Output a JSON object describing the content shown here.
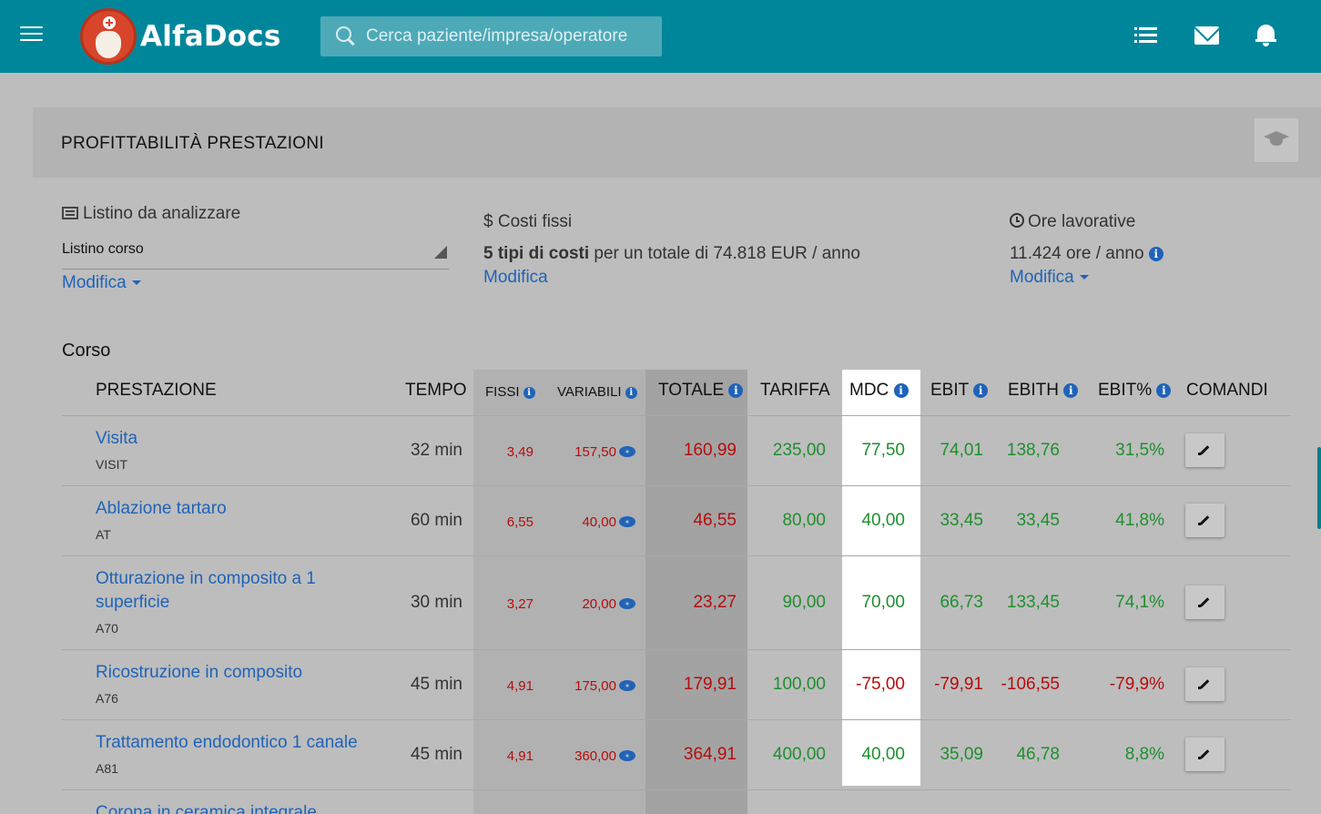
{
  "app": {
    "brand": "AlfaDocs",
    "search_placeholder": "Cerca paziente/impresa/operatore"
  },
  "page": {
    "title": "PROFITTABILITÀ PRESTAZIONI"
  },
  "listino": {
    "label": "Listino da analizzare",
    "value": "Listino corso",
    "action": "Modifica"
  },
  "costi": {
    "label": "$ Costi fissi",
    "summary_bold": "5 tipi di costi",
    "summary_rest": " per un totale di 74.818 EUR / anno",
    "action": "Modifica"
  },
  "ore": {
    "label": "Ore lavorative",
    "value": "11.424 ore / anno",
    "action": "Modifica"
  },
  "table": {
    "title": "Corso",
    "headers": {
      "prestazione": "PRESTAZIONE",
      "tempo": "TEMPO",
      "fissi": "FISSI",
      "variabili": "VARIABILI",
      "totale": "TOTALE",
      "tariffa": "TARIFFA",
      "mdc": "MDC",
      "ebit": "EBIT",
      "ebith": "EBITH",
      "ebitp": "EBIT%",
      "comandi": "COMANDI"
    },
    "rows": [
      {
        "name1": "Visita",
        "name2": "",
        "code": "VISIT",
        "tempo": "32 min",
        "fissi": "3,49",
        "variabili": "157,50",
        "totale": "160,99",
        "tariffa": "235,00",
        "mdc": "77,50",
        "ebit": "74,01",
        "ebith": "138,76",
        "ebitp": "31,5%"
      },
      {
        "name1": "Ablazione tartaro",
        "name2": "",
        "code": "AT",
        "tempo": "60 min",
        "fissi": "6,55",
        "variabili": "40,00",
        "totale": "46,55",
        "tariffa": "80,00",
        "mdc": "40,00",
        "ebit": "33,45",
        "ebith": "33,45",
        "ebitp": "41,8%"
      },
      {
        "name1": "Otturazione in composito a 1",
        "name2": "superficie",
        "code": "A70",
        "tempo": "30 min",
        "fissi": "3,27",
        "variabili": "20,00",
        "totale": "23,27",
        "tariffa": "90,00",
        "mdc": "70,00",
        "ebit": "66,73",
        "ebith": "133,45",
        "ebitp": "74,1%"
      },
      {
        "name1": "Ricostruzione in composito",
        "name2": "",
        "code": "A76",
        "tempo": "45 min",
        "fissi": "4,91",
        "variabili": "175,00",
        "totale": "179,91",
        "tariffa": "100,00",
        "mdc": "-75,00",
        "ebit": "-79,91",
        "ebith": "-106,55",
        "ebitp": "-79,9%"
      },
      {
        "name1": "Trattamento endodontico 1 canale",
        "name2": "",
        "code": "A81",
        "tempo": "45 min",
        "fissi": "4,91",
        "variabili": "360,00",
        "totale": "364,91",
        "tariffa": "400,00",
        "mdc": "40,00",
        "ebit": "35,09",
        "ebith": "46,78",
        "ebitp": "8,8%"
      },
      {
        "name1": "Corona in ceramica integrale",
        "name2": "",
        "code": ""
      }
    ]
  }
}
